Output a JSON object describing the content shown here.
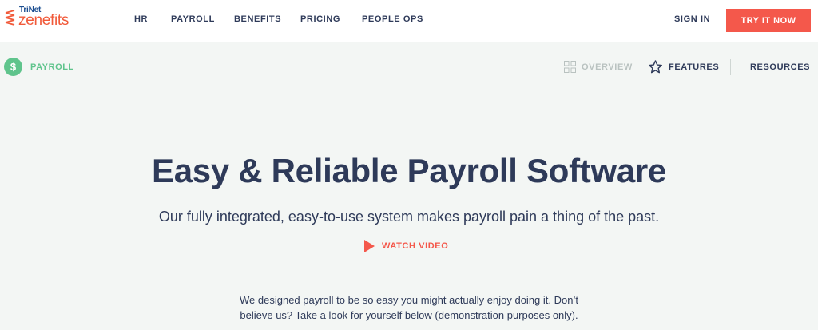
{
  "brand": {
    "parent": "TriNet",
    "name": "zenefits",
    "accent": "#f4584b",
    "green": "#5fc48c",
    "navy": "#2e3a59"
  },
  "nav": {
    "items": [
      "HR",
      "PAYROLL",
      "BENEFITS",
      "PRICING",
      "PEOPLE OPS"
    ],
    "sign_in": "SIGN IN",
    "cta": "TRY IT NOW"
  },
  "subnav": {
    "section": "PAYROLL",
    "section_icon": "dollar-icon",
    "overview": "OVERVIEW",
    "overview_icon": "grid-icon",
    "features": "FEATURES",
    "features_icon": "star-icon",
    "resources": "RESOURCES"
  },
  "hero": {
    "title": "Easy & Reliable Payroll Software",
    "subtitle": "Our fully integrated, easy-to-use system makes payroll pain a thing of the past.",
    "watch_label": "WATCH VIDEO",
    "watch_icon": "play-icon"
  },
  "body": {
    "text_line1": "We designed payroll to be so easy you might actually enjoy doing it. Don’t",
    "text_line2": "believe us? Take a look for yourself below (demonstration purposes only)."
  }
}
